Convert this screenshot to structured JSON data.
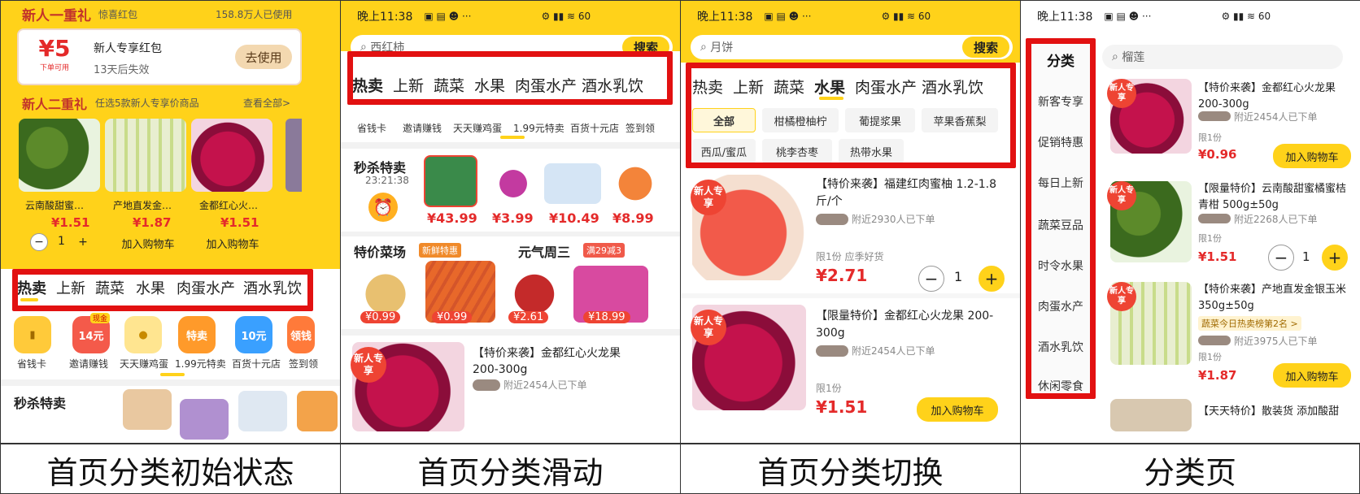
{
  "panel1": {
    "header_left": "新人一重礼",
    "header_small": "惊喜红包",
    "header_right": "158.8万人已使用",
    "coupon_amount": "¥5",
    "coupon_sub": "下单可用",
    "coupon_title": "新人专享红包",
    "coupon_expire": "13天后失效",
    "coupon_btn": "去使用",
    "section2_title": "新人二重礼",
    "section2_sub": "任选5款新人专享价商品",
    "section2_more": "查看全部>",
    "products": [
      {
        "name": "云南酸甜蜜…",
        "price": "¥1.51"
      },
      {
        "name": "产地直发金…",
        "price": "¥1.87"
      },
      {
        "name": "金都红心火…",
        "price": "¥1.51"
      }
    ],
    "qty": "1",
    "cart_btn": "加入购物车",
    "tabs": [
      "热卖",
      "上新",
      "蔬菜",
      "水果",
      "肉蛋水产",
      "酒水乳饮"
    ],
    "icons": [
      {
        "label": "省钱卡",
        "tag": ""
      },
      {
        "label": "邀请赚钱",
        "tag": "14元"
      },
      {
        "label": "天天赚鸡蛋",
        "tag": ""
      },
      {
        "label": "1.99元特卖",
        "tag": "特卖"
      },
      {
        "label": "百货十元店",
        "tag": "10元"
      },
      {
        "label": "签到领",
        "tag": "领钱"
      }
    ],
    "icon_badge": "现金",
    "flash_title": "秒杀特卖"
  },
  "panel2": {
    "time": "晚上11:38",
    "search_placeholder": "西红柿",
    "search_btn": "搜索",
    "tabs": [
      "热卖",
      "上新",
      "蔬菜",
      "水果",
      "肉蛋水产",
      "酒水乳饮"
    ],
    "icons": [
      "省钱卡",
      "邀请赚钱",
      "天天赚鸡蛋",
      "1.99元特卖",
      "百货十元店",
      "签到领"
    ],
    "flash_title": "秒杀特卖",
    "flash_time": "23:21:38",
    "flash_prices": [
      "¥43.99",
      "¥3.99",
      "¥10.49",
      "¥8.99"
    ],
    "market_title": "特价菜场",
    "market_tag": "新鲜特惠",
    "yuanqi_title": "元气周三",
    "yuanqi_tag": "满29减3",
    "market_prices": [
      "¥0.99",
      "¥0.99",
      "¥2.61",
      "¥18.99"
    ],
    "item_badge": "新人专享",
    "item_title": "【特价来袭】金都红心火龙果 200-300g",
    "item_buyers": "附近2454人已下单"
  },
  "panel3": {
    "time": "晚上11:38",
    "search_placeholder": "月饼",
    "search_btn": "搜索",
    "tabs": [
      "热卖",
      "上新",
      "蔬菜",
      "水果",
      "肉蛋水产",
      "酒水乳饮"
    ],
    "chips": [
      "全部",
      "柑橘橙柚柠",
      "葡提浆果",
      "苹果香蕉梨",
      "西瓜/蜜瓜",
      "桃李杏枣",
      "热带水果"
    ],
    "items": [
      {
        "badge": "新人专享",
        "title": "【特价来袭】福建红肉蜜柚 1.2-1.8斤/个",
        "buyers": "附近2930人已下单",
        "limit": "限1份  应季好货",
        "price": "¥2.71",
        "qty": "1"
      },
      {
        "badge": "新人专享",
        "title": "【限量特价】金都红心火龙果 200-300g",
        "buyers": "附近2454人已下单",
        "limit": "限1份",
        "price": "¥1.51",
        "cart": "加入购物车"
      }
    ]
  },
  "panel4": {
    "time": "晚上11:38",
    "search_placeholder": "榴莲",
    "categories": [
      "分类",
      "新客专享",
      "促销特惠",
      "每日上新",
      "蔬菜豆品",
      "时令水果",
      "肉蛋水产",
      "酒水乳饮",
      "休闲零食"
    ],
    "items": [
      {
        "badge": "新人专享",
        "title": "【特价来袭】金都红心火龙果 200-300g",
        "buyers": "附近2454人已下单",
        "limit": "限1份",
        "price": "¥0.96",
        "cart": "加入购物车"
      },
      {
        "badge": "新人专享",
        "title": "【限量特价】云南酸甜蜜橘蜜桔 青柑 500g±50g",
        "buyers": "附近2268人已下单",
        "limit": "限1份",
        "price": "¥1.51",
        "qty": "1"
      },
      {
        "badge": "新人专享",
        "title": "【特价来袭】产地直发金银玉米 350g±50g",
        "rank": "蔬菜今日热卖榜第2名 >",
        "buyers": "附近3975人已下单",
        "limit": "限1份",
        "price": "¥1.87",
        "cart": "加入购物车"
      }
    ],
    "bottom_title": "【天天特价】散装货 添加酸甜"
  },
  "captions": [
    "首页分类初始状态",
    "首页分类滑动",
    "首页分类切换",
    "分类页"
  ],
  "colors": {
    "accent": "#ffd21a",
    "red_box": "#e21111",
    "price": "#e42a2a"
  }
}
